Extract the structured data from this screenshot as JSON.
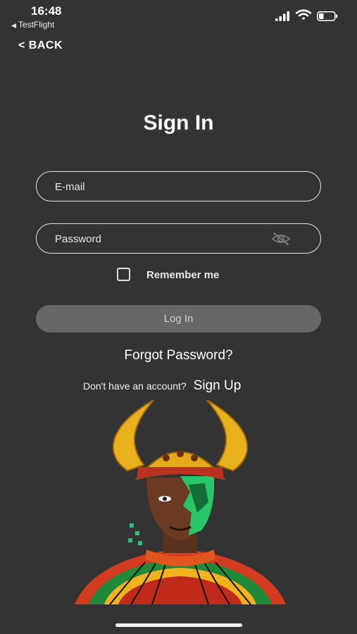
{
  "status_bar": {
    "time": "16:48",
    "back_app": "TestFlight",
    "icons": [
      "cellular-signal-icon",
      "wifi-icon",
      "battery-icon"
    ]
  },
  "nav": {
    "back_label": "< BACK"
  },
  "page": {
    "title": "Sign In"
  },
  "form": {
    "email_placeholder": "E-mail",
    "email_value": "",
    "password_placeholder": "Password",
    "password_value": "",
    "password_toggle_icon": "eye-slash-icon",
    "remember_label": "Remember me",
    "remember_checked": false,
    "login_label": "Log In",
    "forgot_label": "Forgot Password?",
    "no_account_text": "Don't have an account?",
    "signup_label": "Sign Up"
  },
  "colors": {
    "background": "#333333",
    "login_button": "#676767",
    "field_border": "#e6e6e6",
    "text": "#ffffff"
  }
}
